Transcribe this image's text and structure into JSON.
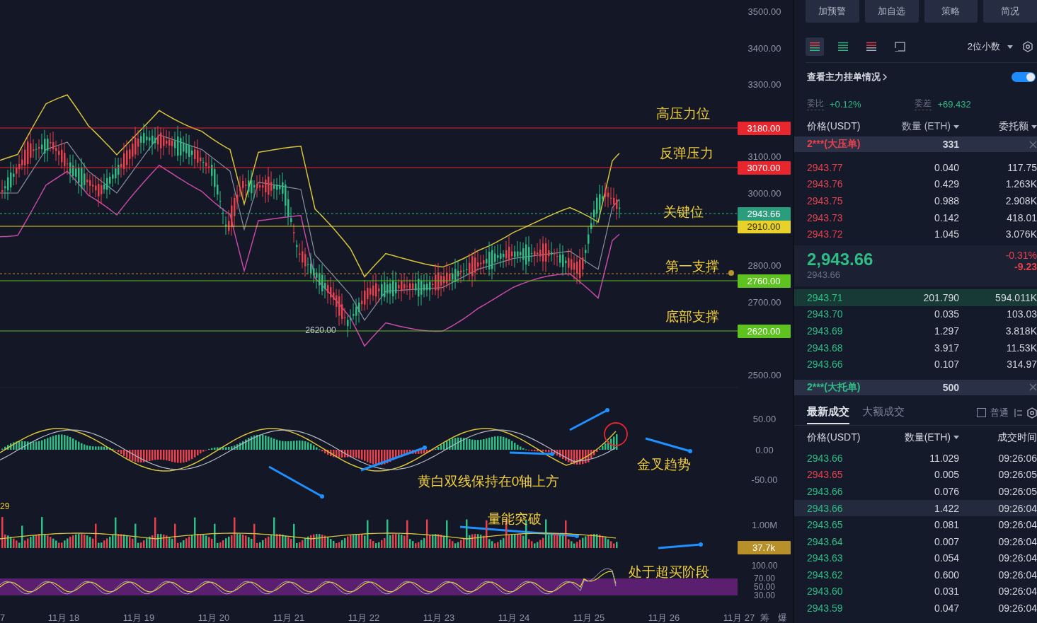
{
  "chart": {
    "price_axis": [
      "3500.00",
      "3400.00",
      "3300.00",
      "3100.00",
      "3000.00",
      "2800.00",
      "2700.00",
      "2500.00"
    ],
    "levels": [
      {
        "label": "高压力位",
        "value": "3180.00",
        "color": "#e8262e"
      },
      {
        "label": "反弹压力",
        "value": "3070.00",
        "color": "#e8262e"
      },
      {
        "label": "关键位",
        "value": "2910.00",
        "color": "#e6d22a"
      },
      {
        "label": "第一支撑",
        "value": "2760.00",
        "color": "#5ec21f"
      },
      {
        "label": "底部支撑",
        "value": "2620.00",
        "color": "#5ec21f"
      }
    ],
    "last_price": "2943.66",
    "low_marker": "2620.00",
    "macd_axis": [
      "50.00",
      "0.00",
      "-50.00"
    ],
    "macd_notes": [
      "黄白双线保持在0轴上方",
      "金叉趋势"
    ],
    "volume_value": "29",
    "volume_axis": "1.00M",
    "volume_tag": "37.7k",
    "volume_note": "量能突破",
    "rsi_axis": [
      "100.00",
      "70.00",
      "50.00",
      "30.00"
    ],
    "rsi_note": "处于超买阶段",
    "dates": [
      "7",
      "11月 18",
      "11月 19",
      "11月 20",
      "11月 21",
      "11月 22",
      "11月 23",
      "11月 24",
      "11月 25",
      "11月 26",
      "11月 27"
    ],
    "corner_tabs": [
      "筹",
      "爆"
    ]
  },
  "panel": {
    "buttons": [
      "加预警",
      "加自选",
      "策略",
      "简况"
    ],
    "views": [
      {
        "selected": true
      },
      {
        "selected": false
      },
      {
        "selected": false
      },
      {
        "selected": false
      }
    ],
    "precision": "2位小数",
    "main_orders": {
      "label": "查看主力挂单情况",
      "on": true
    },
    "ratio": {
      "label": "委比",
      "value": "+0.12%"
    },
    "diff": {
      "label": "委差",
      "value": "+69.432"
    },
    "book_columns": [
      "价格(USDT)",
      "数量 (ETH)",
      "委托额"
    ],
    "big_ask": {
      "label": "2***(大压单)",
      "amount": "331"
    },
    "asks": [
      {
        "price": "2943.77",
        "qty": "0.040",
        "total": "117.75"
      },
      {
        "price": "2943.76",
        "qty": "0.429",
        "total": "1.263K"
      },
      {
        "price": "2943.75",
        "qty": "0.988",
        "total": "2.908K"
      },
      {
        "price": "2943.73",
        "qty": "0.142",
        "total": "418.01"
      },
      {
        "price": "2943.72",
        "qty": "1.045",
        "total": "3.076K"
      }
    ],
    "mid": {
      "price": "2,943.66",
      "mark": "2943.66",
      "change_pct": "-0.31%",
      "change": "-9.23"
    },
    "bids": [
      {
        "price": "2943.71",
        "qty": "201.790",
        "total": "594.011K",
        "selected": true
      },
      {
        "price": "2943.70",
        "qty": "0.035",
        "total": "103.03",
        "selected": false
      },
      {
        "price": "2943.69",
        "qty": "1.297",
        "total": "3.818K",
        "selected": false
      },
      {
        "price": "2943.68",
        "qty": "3.917",
        "total": "11.53K",
        "selected": false
      },
      {
        "price": "2943.66",
        "qty": "0.107",
        "total": "314.97",
        "selected": false
      }
    ],
    "big_bid": {
      "label": "2***(大托单)",
      "amount": "500"
    },
    "trade_tabs": [
      {
        "label": "最新成交",
        "selected": true
      },
      {
        "label": "大额成交",
        "selected": false
      }
    ],
    "normal_filter": {
      "label": "普通",
      "checked": false
    },
    "trade_columns": [
      "价格(USDT)",
      "数量(ETH)",
      "成交时间"
    ],
    "trades": [
      {
        "price": "2943.66",
        "qty": "11.029",
        "time": "09:26:06",
        "color": "#2ebd85",
        "selected": false
      },
      {
        "price": "2943.65",
        "qty": "0.005",
        "time": "09:26:05",
        "color": "#e8414d",
        "selected": false
      },
      {
        "price": "2943.66",
        "qty": "0.076",
        "time": "09:26:05",
        "color": "#2ebd85",
        "selected": false
      },
      {
        "price": "2943.66",
        "qty": "1.422",
        "time": "09:26:04",
        "color": "#2ebd85",
        "selected": true
      },
      {
        "price": "2943.65",
        "qty": "0.081",
        "time": "09:26:04",
        "color": "#2ebd85",
        "selected": false
      },
      {
        "price": "2943.64",
        "qty": "0.007",
        "time": "09:26:04",
        "color": "#2ebd85",
        "selected": false
      },
      {
        "price": "2943.63",
        "qty": "0.054",
        "time": "09:26:04",
        "color": "#2ebd85",
        "selected": false
      },
      {
        "price": "2943.62",
        "qty": "0.600",
        "time": "09:26:04",
        "color": "#2ebd85",
        "selected": false
      },
      {
        "price": "2943.60",
        "qty": "0.031",
        "time": "09:26:04",
        "color": "#2ebd85",
        "selected": false
      },
      {
        "price": "2943.59",
        "qty": "0.047",
        "time": "09:26:04",
        "color": "#2ebd85",
        "selected": false
      }
    ]
  }
}
